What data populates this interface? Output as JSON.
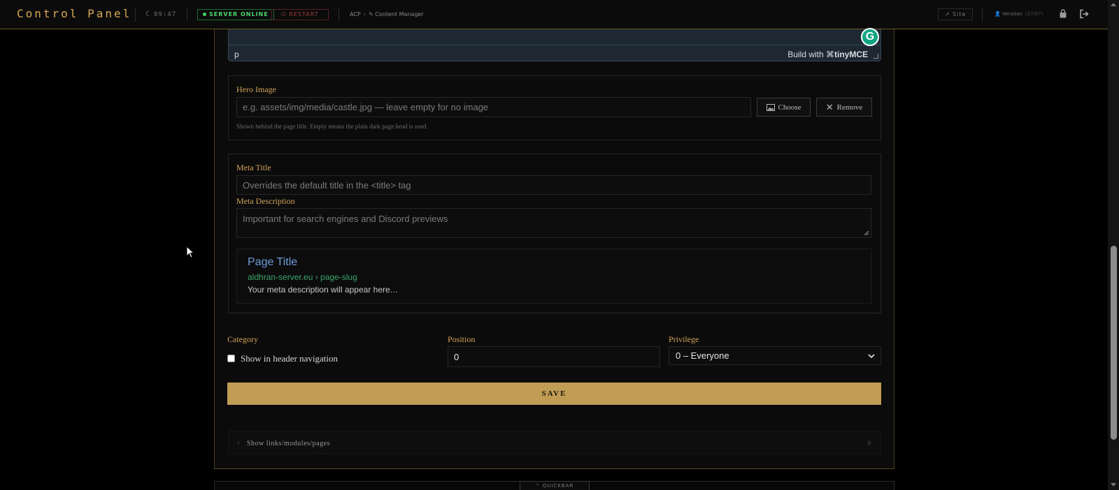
{
  "header": {
    "brand": "Control Panel",
    "clock": "09:47",
    "server_status": "SERVER ONLINE",
    "restart_label": "RESTART",
    "breadcrumb_root": "ACP",
    "breadcrumb_current": "Content Manager",
    "site_label": "Site",
    "username": "Veradan",
    "user_extra": "(27/67)"
  },
  "editor": {
    "element_path": "p",
    "built_with": "Build with",
    "brand": "tinyMCE"
  },
  "hero": {
    "label": "Hero Image",
    "placeholder": "e.g. assets/img/media/castle.jpg — leave empty for no image",
    "choose_label": "Choose",
    "remove_label": "Remove",
    "hint": "Shown behind the page title. Empty means the plain dark page head is used."
  },
  "meta": {
    "title_label": "Meta Title",
    "title_placeholder": "Overrides the default title in the <title> tag",
    "desc_label": "Meta Description",
    "desc_placeholder": "Important for search engines and Discord previews",
    "preview_title": "Page Title",
    "preview_url": "aldhran-server.eu › page-slug",
    "preview_desc": "Your meta description will appear here…"
  },
  "settings": {
    "category_label": "Category",
    "show_in_nav_label": "Show in header navigation",
    "position_label": "Position",
    "position_value": "0",
    "privilege_label": "Privilege",
    "privilege_value": "0 – Everyone"
  },
  "save_label": "SAVE",
  "accordion": {
    "label": "Show links/modules/pages",
    "count": "9"
  },
  "quickbar_label": "QUICKBAR",
  "colors": {
    "accent": "#c09c55",
    "label": "#d4a45a",
    "online": "#48d86a",
    "danger": "#a23c3c"
  }
}
